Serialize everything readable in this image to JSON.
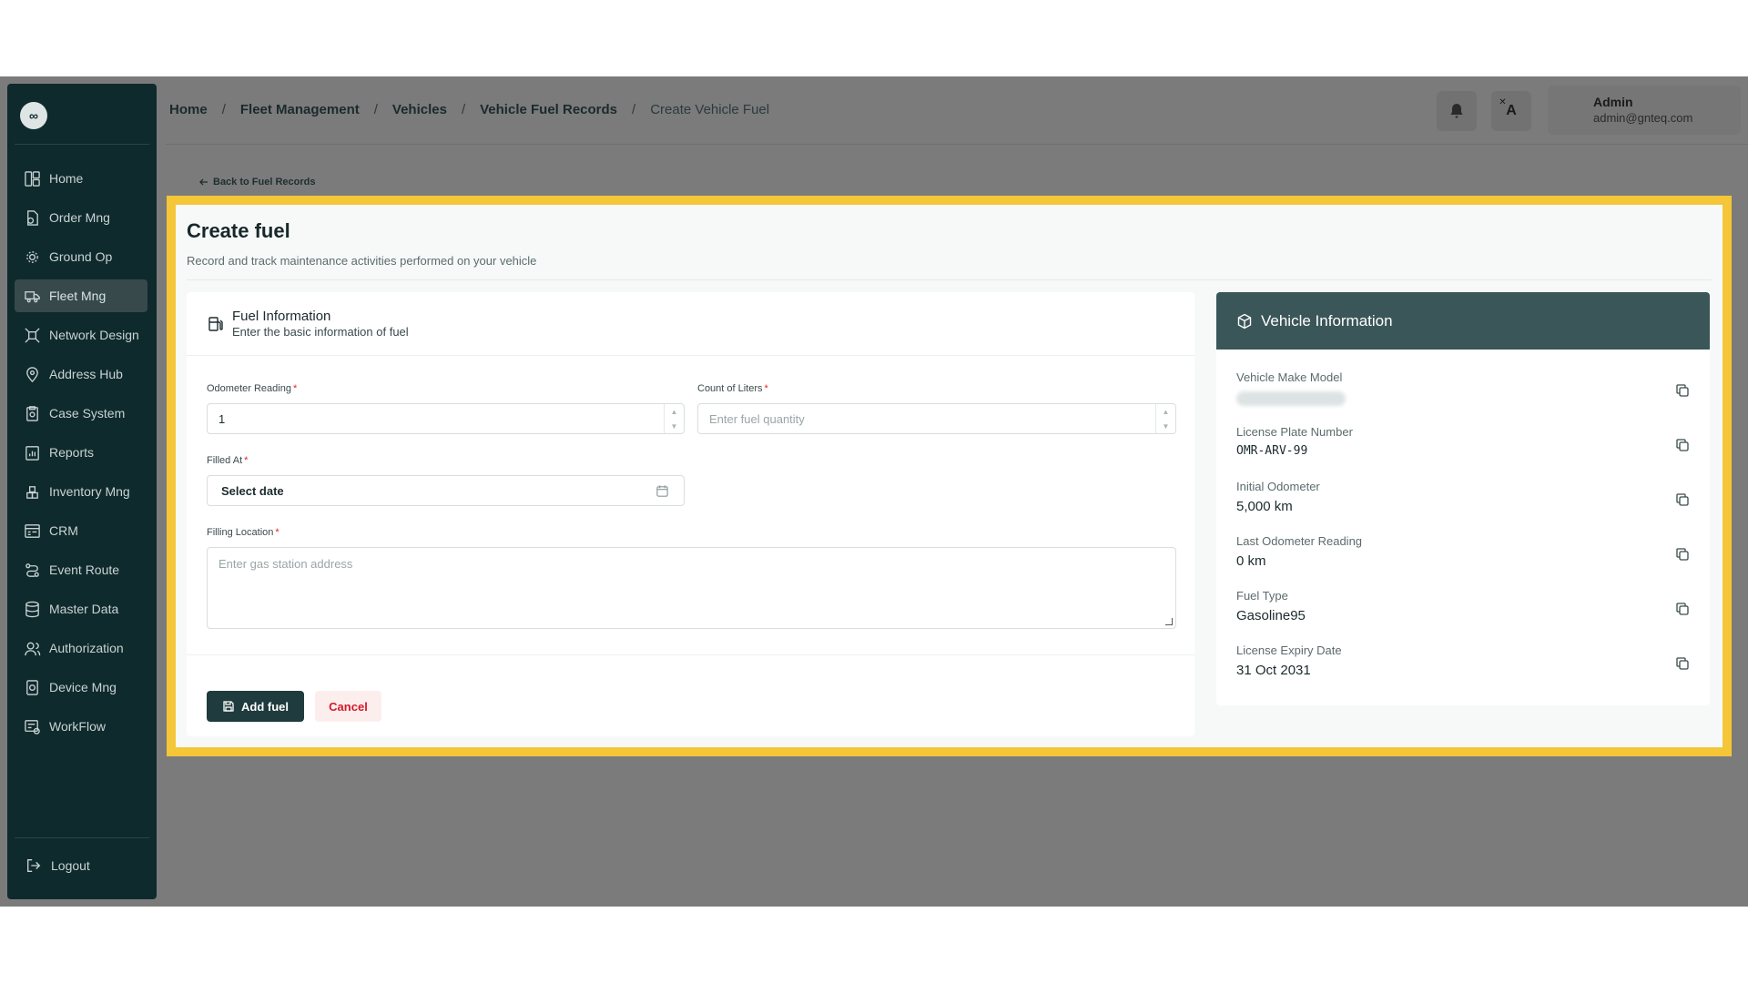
{
  "sidebar": {
    "logo": "∞",
    "items": [
      {
        "label": "Home",
        "icon": "home-icon"
      },
      {
        "label": "Order Mng",
        "icon": "order-icon"
      },
      {
        "label": "Ground Op",
        "icon": "ground-op-icon"
      },
      {
        "label": "Fleet Mng",
        "icon": "truck-icon",
        "active": true
      },
      {
        "label": "Network Design",
        "icon": "network-icon"
      },
      {
        "label": "Address Hub",
        "icon": "location-pin-icon"
      },
      {
        "label": "Case System",
        "icon": "clipboard-icon"
      },
      {
        "label": "Reports",
        "icon": "report-icon"
      },
      {
        "label": "Inventory Mng",
        "icon": "inventory-icon"
      },
      {
        "label": "CRM",
        "icon": "crm-icon"
      },
      {
        "label": "Event Route",
        "icon": "route-icon"
      },
      {
        "label": "Master Data",
        "icon": "database-icon"
      },
      {
        "label": "Authorization",
        "icon": "users-icon"
      },
      {
        "label": "Device Mng",
        "icon": "device-icon"
      },
      {
        "label": "WorkFlow",
        "icon": "workflow-icon"
      }
    ],
    "logout": "Logout"
  },
  "header": {
    "breadcrumb": [
      "Home",
      "Fleet Management",
      "Vehicles",
      "Vehicle Fuel Records"
    ],
    "breadcrumb_current": "Create Vehicle Fuel",
    "separator": "/",
    "user_name": "Admin",
    "user_email": "admin@gnteq.com",
    "lang_glyph": "A"
  },
  "back_link": "Back to Fuel Records",
  "page": {
    "title": "Create fuel",
    "subtitle": "Record and track maintenance activities performed on your vehicle"
  },
  "form": {
    "section_title": "Fuel Information",
    "section_desc": "Enter the basic information of fuel",
    "odometer_label": "Odometer Reading",
    "odometer_value": "1",
    "liters_label": "Count of Liters",
    "liters_placeholder": "Enter fuel quantity",
    "filled_at_label": "Filled At",
    "filled_at_value": "Select date",
    "location_label": "Filling Location",
    "location_placeholder": "Enter gas station address",
    "required_mark": "*",
    "submit_label": "Add fuel",
    "cancel_label": "Cancel"
  },
  "vehicle": {
    "title": "Vehicle Information",
    "fields": [
      {
        "label": "Vehicle Make Model",
        "value": ""
      },
      {
        "label": "License Plate Number",
        "value": "OMR-ARV-99"
      },
      {
        "label": "Initial Odometer",
        "value": "5,000 km"
      },
      {
        "label": "Last Odometer Reading",
        "value": "0 km"
      },
      {
        "label": "Fuel Type",
        "value": "Gasoline95"
      },
      {
        "label": "License Expiry Date",
        "value": "31 Oct 2031"
      }
    ]
  },
  "colors": {
    "sidebar_bg": "#0f2a2c",
    "highlight": "#f4c638",
    "primary": "#1f3b3d",
    "vehicle_header": "#3a5658",
    "required": "#e02424"
  }
}
